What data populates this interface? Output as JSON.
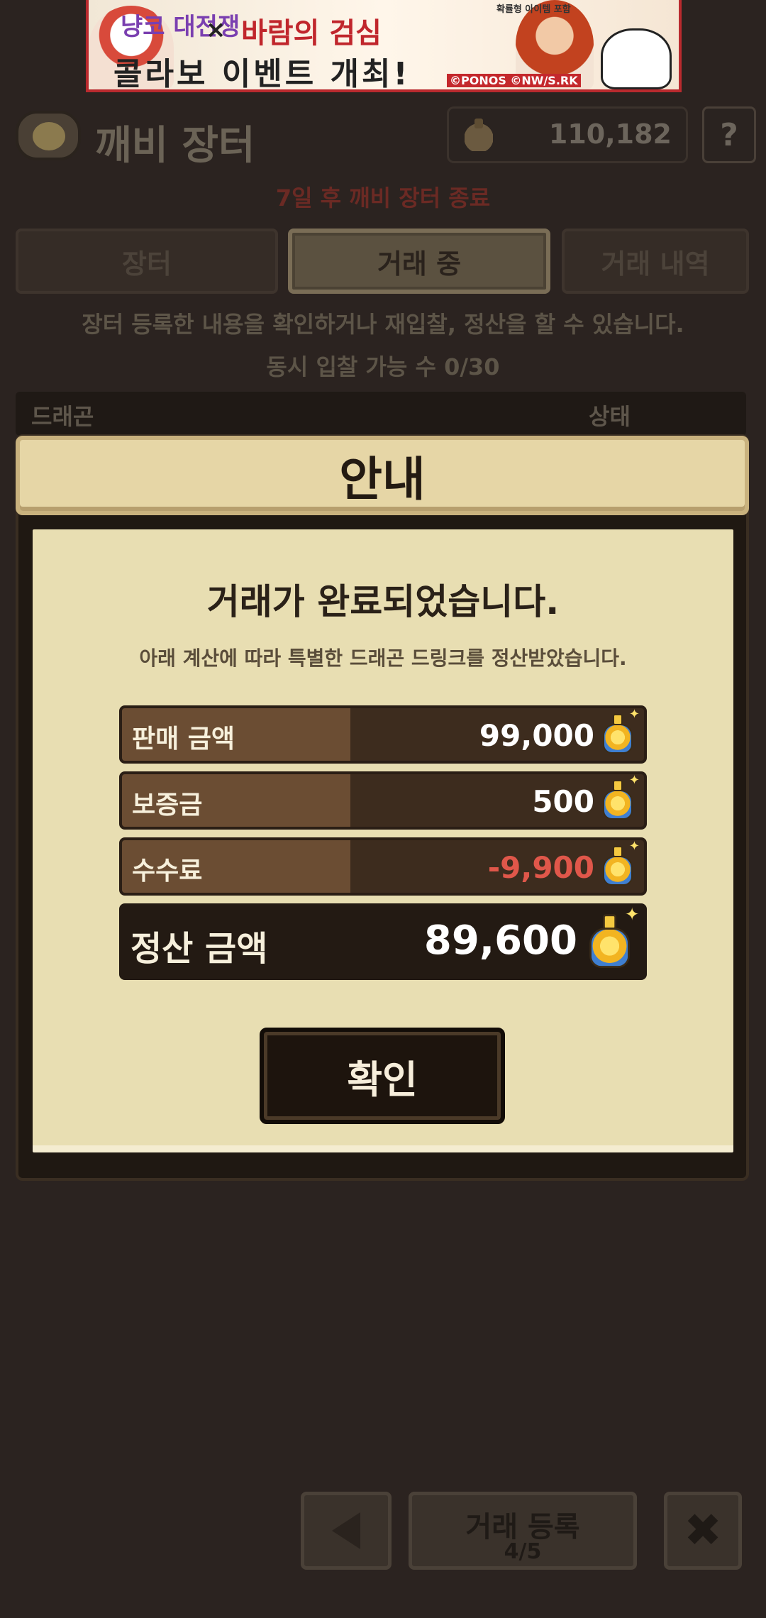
{
  "banner": {
    "logo_left": "냥코 대전쟁",
    "cross": "×",
    "logo_right": "바람의 검심",
    "headline": "콜라보 이벤트 개최!",
    "small_note": "확률형 아이템 포함",
    "copyright": "©PONOS ©NW/S.RK"
  },
  "header": {
    "title": "깨비 장터",
    "currency_icon": "dragon-drink-icon",
    "currency_value": "110,182",
    "help_label": "?"
  },
  "notice": "7일 후 깨비 장터 종료",
  "tabs": [
    {
      "label": "장터"
    },
    {
      "label": "거래 중"
    },
    {
      "label": "거래 내역"
    }
  ],
  "info": {
    "line1": "장터 등록한 내용을 확인하거나 재입찰, 정산을 할 수 있습니다.",
    "line2": "동시 입찰 가능 수 0/30"
  },
  "table": {
    "col_item": "드래곤",
    "col_status": "상태"
  },
  "dialog": {
    "title": "안내",
    "heading": "거래가 완료되었습니다.",
    "subtext": "아래 계산에 따라 특별한 드래곤 드링크를 정산받았습니다.",
    "rows": [
      {
        "label": "판매 금액",
        "value": "99,000"
      },
      {
        "label": "보증금",
        "value": "500"
      },
      {
        "label": "수수료",
        "value": "-9,900"
      }
    ],
    "total": {
      "label": "정산 금액",
      "value": "89,600"
    },
    "confirm_label": "확인"
  },
  "bottom_bar": {
    "back_icon": "triangle-left-icon",
    "register_label": "거래 등록",
    "register_count": "4/5",
    "close_label": "✖"
  },
  "colors": {
    "background": "#2b2320",
    "dialog_body": "#e8deb2",
    "negative": "#e0574a",
    "accent_red": "#b92a2e"
  }
}
